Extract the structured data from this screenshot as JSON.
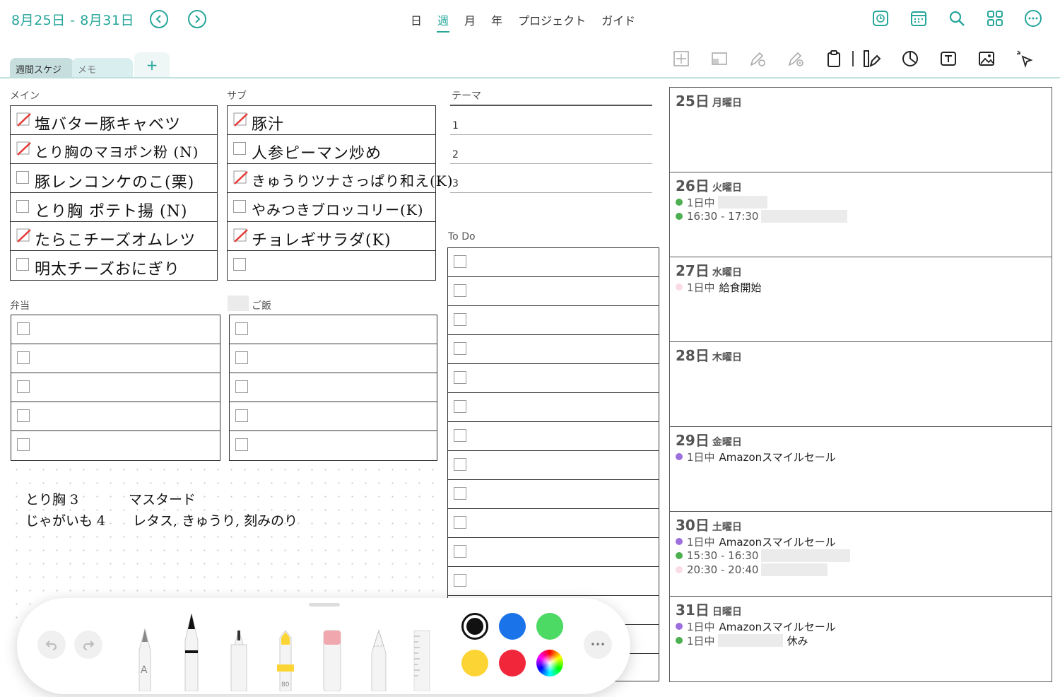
{
  "header": {
    "date_range": "8月25日 - 8月31日",
    "prev_label": "<",
    "next_label": ">",
    "view_tabs": [
      "日",
      "週",
      "月",
      "年",
      "プロジェクト",
      "ガイド"
    ],
    "active_view": "週"
  },
  "notebook_tabs": {
    "items": [
      "週間スケジ",
      "メモ"
    ],
    "add_label": "+"
  },
  "sections": {
    "main": "メイン",
    "sub": "サブ",
    "theme": "テーマ",
    "bento": "弁当",
    "rice": "ご飯",
    "todo": "To Do"
  },
  "main_items": [
    {
      "text": "塩バター豚キャベツ",
      "checked": true
    },
    {
      "text": "とり胸のマヨポン粉 (N)",
      "checked": true
    },
    {
      "text": "豚レンコンケのこ(栗)",
      "checked": false
    },
    {
      "text": "とり胸 ポテト揚 (N)",
      "checked": false
    },
    {
      "text": "たらこチーズオムレツ",
      "checked": true
    },
    {
      "text": "明太チーズおにぎり",
      "checked": false
    }
  ],
  "sub_items": [
    {
      "text": "豚汁",
      "checked": true
    },
    {
      "text": "人参ピーマン炒め",
      "checked": false
    },
    {
      "text": "きゅうりツナさっぱり和え(K)",
      "checked": true
    },
    {
      "text": "やみつきブロッコリー(K)",
      "checked": false
    },
    {
      "text": "チョレギサラダ(K)",
      "checked": true
    },
    {
      "text": "",
      "checked": false
    }
  ],
  "theme_items": [
    "1",
    "2",
    "3"
  ],
  "memo": {
    "line1a": "とり胸 3",
    "line1b": "マスタード",
    "line2a": "じゃがいも 4",
    "line2b": "レタス, きゅうり, 刻みのり"
  },
  "calendar": [
    {
      "num": "25日",
      "name": "月曜日",
      "events": []
    },
    {
      "num": "26日",
      "name": "火曜日",
      "events": [
        {
          "time": "1日中",
          "title": "",
          "color": "#4caf50",
          "redact": 70
        },
        {
          "time": "16:30 - 17:30",
          "title": "",
          "color": "#4caf50",
          "redact": 122
        }
      ]
    },
    {
      "num": "27日",
      "name": "水曜日",
      "events": [
        {
          "time": "1日中",
          "title": "給食開始",
          "color": "#fbdbe6",
          "redact": 0
        }
      ]
    },
    {
      "num": "28日",
      "name": "木曜日",
      "events": []
    },
    {
      "num": "29日",
      "name": "金曜日",
      "events": [
        {
          "time": "1日中",
          "title": "Amazonスマイルセール",
          "color": "#9c6ede",
          "redact": 0
        }
      ]
    },
    {
      "num": "30日",
      "name": "土曜日",
      "events": [
        {
          "time": "1日中",
          "title": "Amazonスマイルセール",
          "color": "#9c6ede",
          "redact": 0
        },
        {
          "time": "15:30 - 16:30",
          "title": "",
          "color": "#4caf50",
          "redact": 126
        },
        {
          "time": "20:30 - 20:40",
          "title": "",
          "color": "#fbdbe6",
          "redact": 94
        }
      ]
    },
    {
      "num": "31日",
      "name": "日曜日",
      "events": [
        {
          "time": "1日中",
          "title": "Amazonスマイルセール",
          "color": "#9c6ede",
          "redact": 0
        },
        {
          "time": "1日中",
          "title": "休み",
          "color": "#4caf50",
          "redact": 92
        }
      ]
    }
  ],
  "pen_toolbar": {
    "marker_size": "80",
    "pencil_letter": "A",
    "more_label": "•••",
    "colors": [
      "#111111",
      "#1a73e8",
      "#4cd964",
      "#fcd535",
      "#f2263b"
    ]
  },
  "accent": "#26a69a"
}
